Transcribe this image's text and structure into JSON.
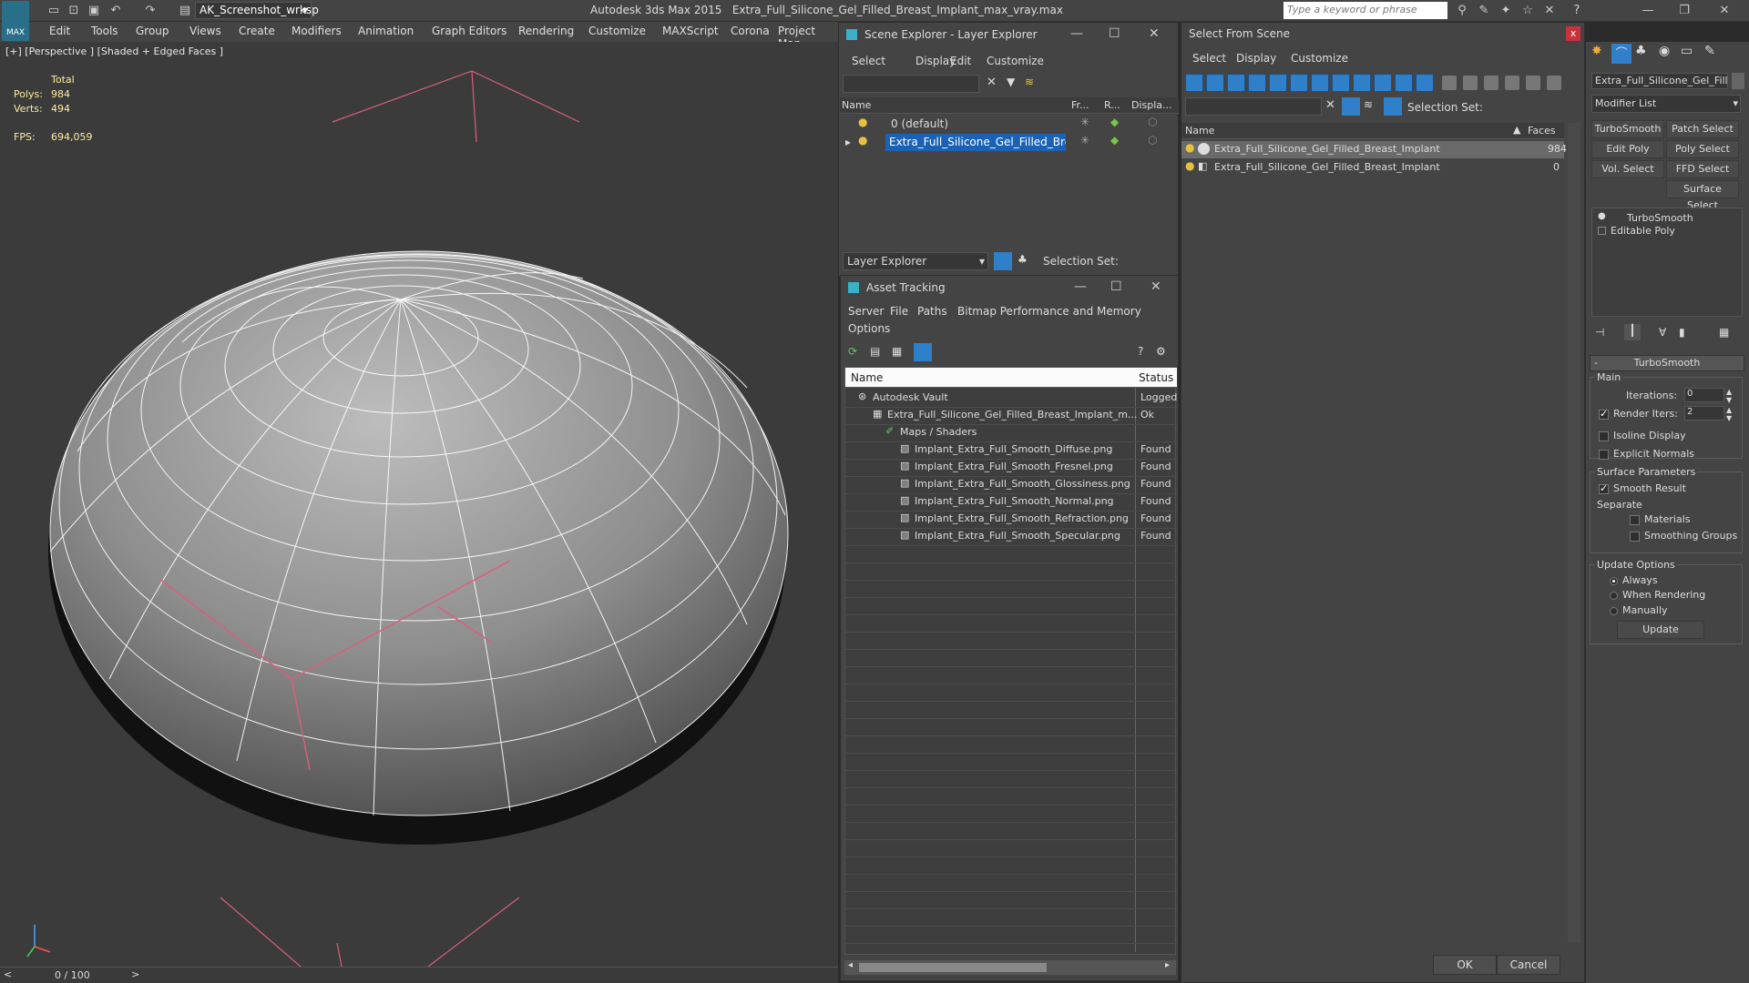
{
  "titlebar": {
    "workspace": "AK_Screenshot_wrksp",
    "app": "Autodesk 3ds Max 2015",
    "file": "Extra_Full_Silicone_Gel_Filled_Breast_Implant_max_vray.max",
    "search_placeholder": "Type a keyword or phrase"
  },
  "menu": [
    "Edit",
    "Tools",
    "Group",
    "Views",
    "Create",
    "Modifiers",
    "Animation",
    "Graph Editors",
    "Rendering",
    "Customize",
    "MAXScript",
    "Corona",
    "Project Man"
  ],
  "viewport": {
    "label": "[+] [Perspective ] [Shaded + Edged Faces ]",
    "stats_header": "Total",
    "polys_label": "Polys:",
    "polys": "984",
    "verts_label": "Verts:",
    "verts": "494",
    "fps_label": "FPS:",
    "fps": "694,059"
  },
  "timeline": {
    "frame": "0 / 100"
  },
  "scene_explorer": {
    "title": "Scene Explorer - Layer Explorer",
    "menu": [
      "Select",
      "Display",
      "Edit",
      "Customize"
    ],
    "columns": [
      "Name",
      "Fr...",
      "R...",
      "Displa..."
    ],
    "rows": [
      "0 (default)",
      "Extra_Full_Silicone_Gel_Filled_Breast..."
    ],
    "footer_dropdown": "Layer Explorer",
    "selection_set": "Selection Set:"
  },
  "asset_tracking": {
    "title": "Asset Tracking",
    "menu": [
      "Server",
      "File",
      "Paths",
      "Bitmap Performance and Memory"
    ],
    "menu2": "Options",
    "columns": [
      "Name",
      "Status"
    ],
    "rows": [
      {
        "name": "Autodesk Vault",
        "status": "Logged"
      },
      {
        "name": "Extra_Full_Silicone_Gel_Filled_Breast_Implant_m...",
        "status": "Ok"
      },
      {
        "name": "Maps / Shaders",
        "status": ""
      },
      {
        "name": "Implant_Extra_Full_Smooth_Diffuse.png",
        "status": "Found"
      },
      {
        "name": "Implant_Extra_Full_Smooth_Fresnel.png",
        "status": "Found"
      },
      {
        "name": "Implant_Extra_Full_Smooth_Glossiness.png",
        "status": "Found"
      },
      {
        "name": "Implant_Extra_Full_Smooth_Normal.png",
        "status": "Found"
      },
      {
        "name": "Implant_Extra_Full_Smooth_Refraction.png",
        "status": "Found"
      },
      {
        "name": "Implant_Extra_Full_Smooth_Specular.png",
        "status": "Found"
      }
    ]
  },
  "select_from_scene": {
    "title": "Select From Scene",
    "menu": [
      "Select",
      "Display",
      "Customize"
    ],
    "selection_set": "Selection Set:",
    "columns": [
      "Name",
      "Faces"
    ],
    "rows": [
      {
        "name": "Extra_Full_Silicone_Gel_Filled_Breast_Implant",
        "faces": "984"
      },
      {
        "name": "Extra_Full_Silicone_Gel_Filled_Breast_Implant",
        "faces": "0"
      }
    ],
    "ok": "OK",
    "cancel": "Cancel"
  },
  "command_panel": {
    "object_name": "Extra_Full_Silicone_Gel_Filled",
    "modifier_list": "Modifier List",
    "buttons": [
      "TurboSmooth",
      "Patch Select",
      "Edit Poly",
      "Poly Select",
      "Vol. Select",
      "FFD Select",
      "Surface Select"
    ],
    "stack": [
      "TurboSmooth",
      "Editable Poly"
    ],
    "rollout_title": "TurboSmooth",
    "main": "Main",
    "iterations_label": "Iterations:",
    "iterations": "0",
    "render_iters_label": "Render Iters:",
    "render_iters": "2",
    "isoline": "Isoline Display",
    "explicit_normals": "Explicit Normals",
    "surface_params": "Surface Parameters",
    "smooth_result": "Smooth Result",
    "separate": "Separate",
    "materials": "Materials",
    "smoothing_groups": "Smoothing Groups",
    "update_options": "Update Options",
    "always": "Always",
    "when_rendering": "When Rendering",
    "manually": "Manually",
    "update": "Update"
  },
  "colors": {
    "accent": "#0078d7",
    "selected": "#1a62b5",
    "bg": "#444444"
  }
}
